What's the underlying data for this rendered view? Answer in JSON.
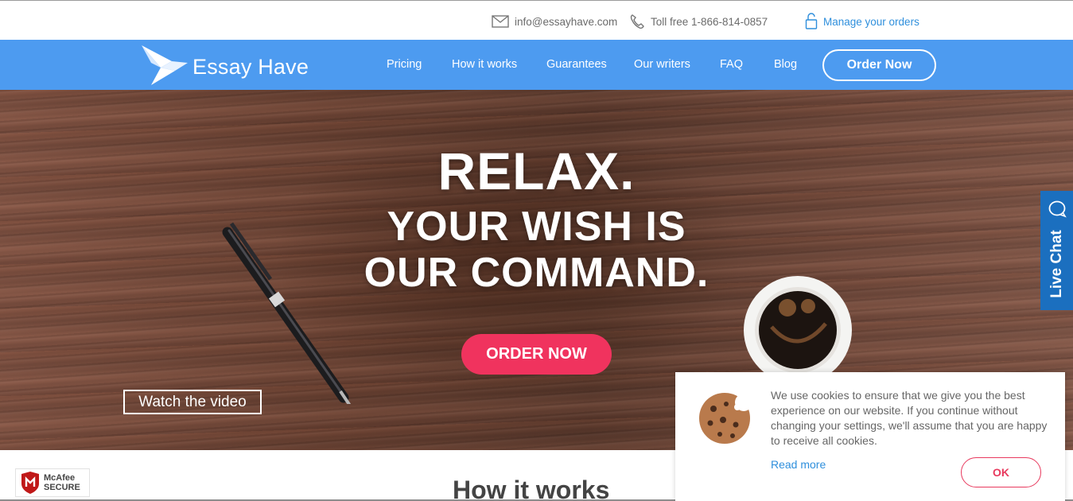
{
  "topbar": {
    "email": "info@essayhave.com",
    "phone": "Toll free 1-866-814-0857",
    "manage_orders": "Manage your orders"
  },
  "nav": {
    "logo_text": "Essay Have",
    "links": [
      {
        "label": "Pricing"
      },
      {
        "label": "How it works"
      },
      {
        "label": "Guarantees"
      },
      {
        "label": "Our writers"
      },
      {
        "label": "FAQ"
      },
      {
        "label": "Blog"
      }
    ],
    "order_button": "Order Now"
  },
  "hero": {
    "title_line1": "RELAX.",
    "title_line2": "YOUR WISH IS",
    "title_line3": "OUR COMMAND.",
    "cta": "ORDER NOW",
    "watch_video": "Watch the video"
  },
  "live_chat": {
    "label": "Live Chat"
  },
  "badge": {
    "line1": "McAfee",
    "line2": "SECURE"
  },
  "section": {
    "title": "How it works"
  },
  "cookie_banner": {
    "text": "We use cookies to ensure that we give you the best experience on our website. If you continue without changing your settings, we'll assume that you are happy to receive all cookies.",
    "read_more": "Read more",
    "ok": "OK"
  },
  "colors": {
    "nav_bg": "#4d9bf0",
    "cta": "#f0335e",
    "link": "#2f8fdc",
    "live_chat": "#1b6fbf"
  },
  "icons": [
    "envelope-icon",
    "phone-icon",
    "lock-icon",
    "bird-logo-icon",
    "chat-bubble-icon",
    "cookie-icon",
    "mcafee-shield-icon"
  ]
}
